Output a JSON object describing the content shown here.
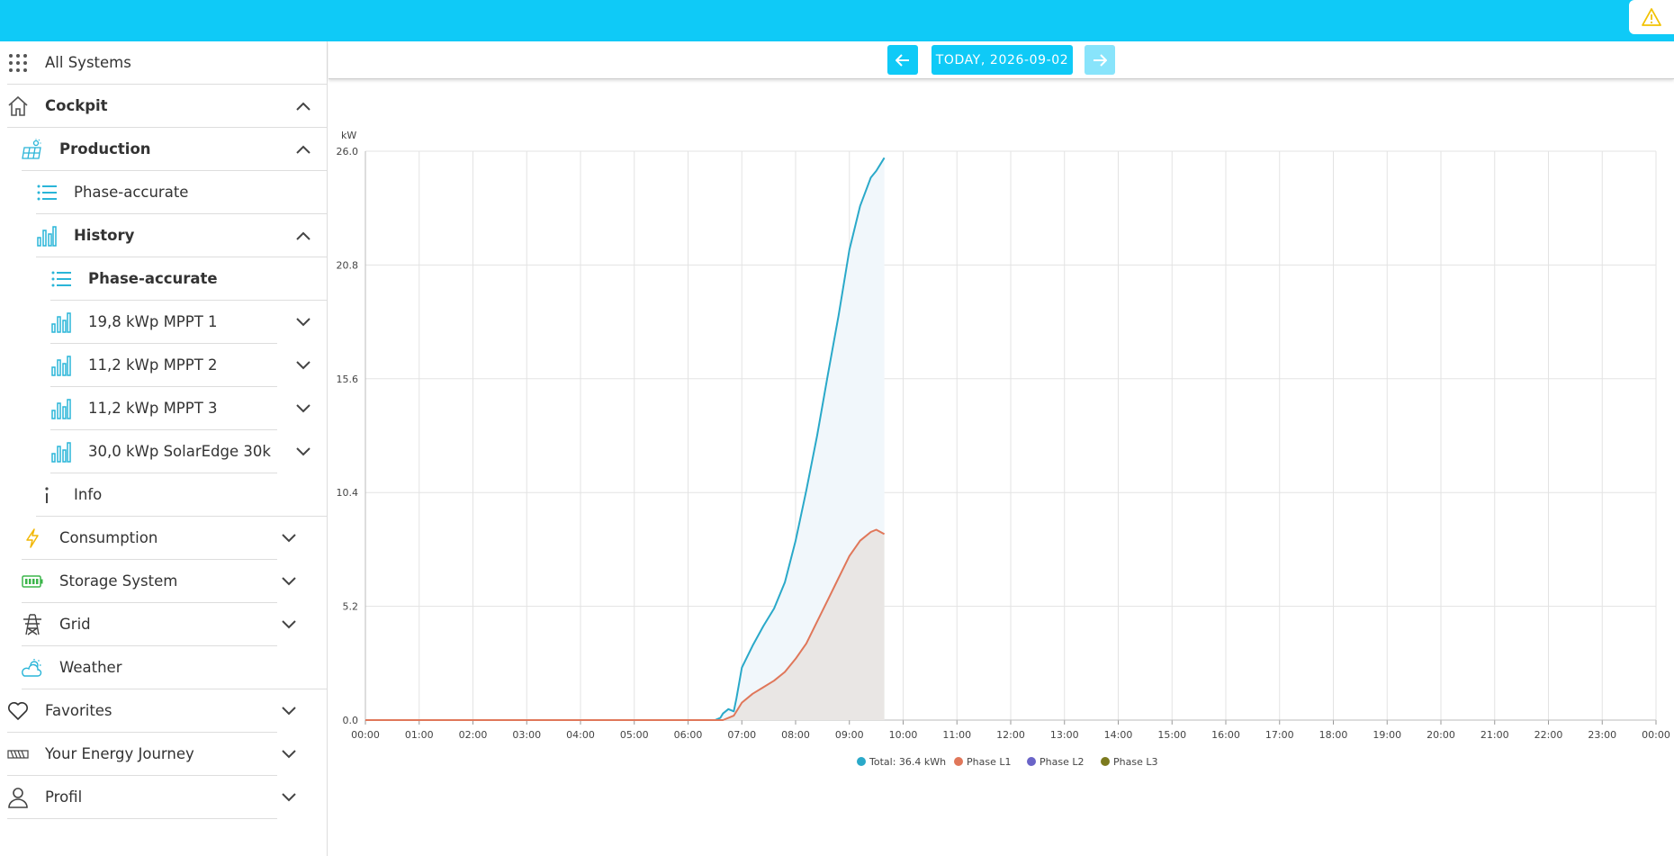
{
  "header": {
    "warning_icon": "warning-triangle-icon",
    "color": "#0fcaf7"
  },
  "sidebar": {
    "all_systems": "All Systems",
    "cockpit": "Cockpit",
    "production": "Production",
    "phase_accurate": "Phase-accurate",
    "history": "History",
    "history_phase_accurate": "Phase-accurate",
    "mppt1": "19,8 kWp MPPT 1",
    "mppt2": "11,2 kWp MPPT 2",
    "mppt3": "11,2 kWp MPPT 3",
    "solaredge": "30,0 kWp SolarEdge 30k",
    "info": "Info",
    "consumption": "Consumption",
    "storage": "Storage System",
    "grid": "Grid",
    "weather": "Weather",
    "favorites": "Favorites",
    "energy_journey": "Your Energy Journey",
    "profil": "Profil"
  },
  "datebar": {
    "date_label": "TODAY, 2026-09-02"
  },
  "chart_data": {
    "type": "area",
    "ylabel": "kW",
    "ylim": [
      0,
      26.0
    ],
    "yticks": [
      "0.0",
      "5.2",
      "10.4",
      "15.6",
      "20.8",
      "26.0"
    ],
    "xticks": [
      "00:00",
      "01:00",
      "02:00",
      "03:00",
      "04:00",
      "05:00",
      "06:00",
      "07:00",
      "08:00",
      "09:00",
      "10:00",
      "11:00",
      "12:00",
      "13:00",
      "14:00",
      "15:00",
      "16:00",
      "17:00",
      "18:00",
      "19:00",
      "20:00",
      "21:00",
      "22:00",
      "23:00",
      "00:00"
    ],
    "xlim_hours": [
      0,
      24
    ],
    "grid": true,
    "legend_position": "bottom",
    "series": [
      {
        "name": "Total: 36.4 kWh",
        "color": "#2aa9c9",
        "fill": "#f1f7fb",
        "x": [
          0,
          6.5,
          6.6,
          6.65,
          6.75,
          6.85,
          6.9,
          7.0,
          7.2,
          7.4,
          7.6,
          7.8,
          8.0,
          8.2,
          8.4,
          8.6,
          8.8,
          9.0,
          9.2,
          9.4,
          9.5,
          9.6,
          9.65
        ],
        "values": [
          0,
          0,
          0.1,
          0.3,
          0.5,
          0.4,
          1.0,
          2.4,
          3.4,
          4.3,
          5.1,
          6.3,
          8.2,
          10.5,
          13.0,
          15.8,
          18.5,
          21.5,
          23.5,
          24.8,
          25.1,
          25.5,
          25.7
        ]
      },
      {
        "name": "Phase L1",
        "color": "#e0775a",
        "fill": "#e9e6e4",
        "x": [
          0,
          6.65,
          6.75,
          6.85,
          7.0,
          7.2,
          7.4,
          7.6,
          7.8,
          8.0,
          8.2,
          8.4,
          8.6,
          8.8,
          9.0,
          9.2,
          9.4,
          9.5,
          9.65
        ],
        "values": [
          0,
          0,
          0.1,
          0.2,
          0.8,
          1.2,
          1.5,
          1.8,
          2.2,
          2.8,
          3.5,
          4.5,
          5.5,
          6.5,
          7.5,
          8.2,
          8.6,
          8.7,
          8.5
        ]
      },
      {
        "name": "Phase L2",
        "color": "#6a64c8",
        "x": [],
        "values": []
      },
      {
        "name": "Phase L3",
        "color": "#7c7a1e",
        "x": [],
        "values": []
      }
    ]
  }
}
